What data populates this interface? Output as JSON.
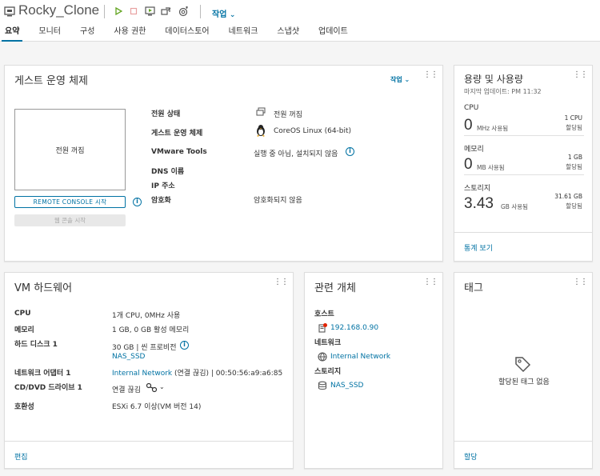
{
  "header": {
    "vm_name": "Rocky_Clone",
    "actions_label": "작업"
  },
  "tabs": [
    {
      "label": "요약"
    },
    {
      "label": "모니터"
    },
    {
      "label": "구성"
    },
    {
      "label": "사용 권한"
    },
    {
      "label": "데이터스토어"
    },
    {
      "label": "네트워크"
    },
    {
      "label": "스냅샷"
    },
    {
      "label": "업데이트"
    }
  ],
  "guest": {
    "title": "게스트 운영 체제",
    "actions_label": "작업",
    "screen_text": "전원 꺼짐",
    "remote_console": "REMOTE CONSOLE 시작",
    "web_console": "웹 콘솔 시작",
    "rows": [
      {
        "label": "전원 상태",
        "value": "전원 꺼짐",
        "icon": "power-state-icon"
      },
      {
        "label": "게스트 운영 체제",
        "value": "CoreOS Linux (64-bit)",
        "icon": "linux-tux-icon"
      },
      {
        "label": "VMware Tools",
        "value": "실행 중 아님, 설치되지 않음",
        "icon": "info-icon"
      },
      {
        "label": "DNS 이름",
        "value": ""
      },
      {
        "label": "IP 주소",
        "value": ""
      },
      {
        "label": "암호화",
        "value": "암호화되지 않음"
      }
    ]
  },
  "capacity": {
    "title": "용량 및 사용량",
    "last_updated": "마지막 업데이트: PM 11:32",
    "items": [
      {
        "label": "CPU",
        "value": "0",
        "unit": "MHz 사용됨",
        "alloc": "1 CPU",
        "alloc_label": "할당됨"
      },
      {
        "label": "메모리",
        "value": "0",
        "unit": "MB 사용됨",
        "alloc": "1 GB",
        "alloc_label": "할당됨"
      },
      {
        "label": "스토리지",
        "value": "3.43",
        "unit": "GB 사용됨",
        "alloc": "31.61 GB",
        "alloc_label": "할당됨"
      }
    ],
    "footer_link": "통계 보기"
  },
  "hardware": {
    "title": "VM 하드웨어",
    "rows": [
      {
        "label": "CPU",
        "value": "1개 CPU, 0MHz 사용"
      },
      {
        "label": "메모리",
        "value": "1 GB, 0 GB 활성 메모리"
      },
      {
        "label": "하드 디스크 1",
        "value": "30 GB | 씬 프로비전",
        "value2": "NAS_SSD"
      },
      {
        "label": "네트워크 어댑터 1",
        "link": "Internal Network",
        "value": "(연결 끊김) | 00:50:56:a9:a6:85"
      },
      {
        "label": "CD/DVD 드라이브 1",
        "value": "연결 끊김"
      },
      {
        "label": "호환성",
        "value": "ESXi 6.7 이상(VM 버전 14)"
      }
    ],
    "footer_link": "편집"
  },
  "related": {
    "title": "관련 개체",
    "groups": [
      {
        "label": "호스트",
        "item": "192.168.0.90"
      },
      {
        "label": "네트워크",
        "item": "Internal Network"
      },
      {
        "label": "스토리지",
        "item": "NAS_SSD"
      }
    ]
  },
  "tags": {
    "title": "태그",
    "empty_text": "할당된 태그 없음",
    "footer_link": "할당"
  },
  "colors": {
    "link": "#0072a3",
    "play": "#62a420",
    "warn": "#e12200"
  }
}
